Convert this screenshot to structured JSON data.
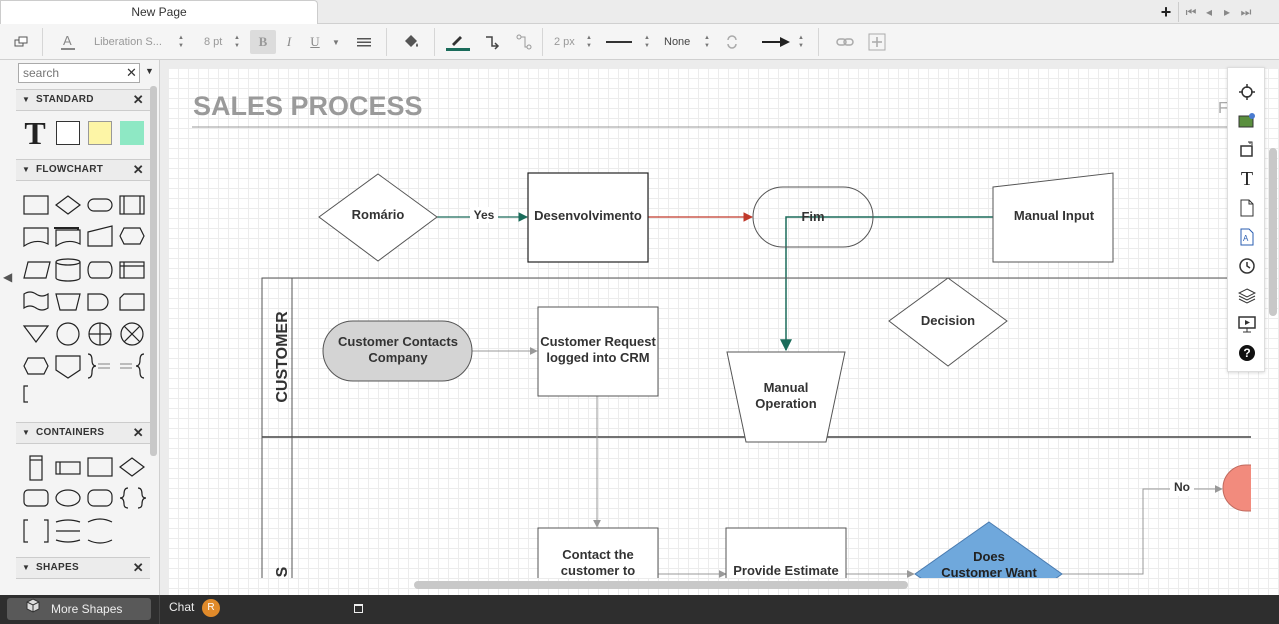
{
  "tabs": {
    "active": "New Page"
  },
  "toolbar": {
    "font_family": "Liberation S...",
    "font_size": "8 pt",
    "line_width": "2 px",
    "line_end": "None"
  },
  "sidebar": {
    "search_placeholder": "search",
    "sections": {
      "standard": "STANDARD",
      "flowchart": "FLOWCHART",
      "containers": "CONTAINERS",
      "shapes": "SHAPES"
    },
    "text_tool_glyph": "T"
  },
  "diagram": {
    "title": "SALES PROCESS",
    "title_right": "F",
    "nodes": {
      "romario": "Romário",
      "desenvolvimento": "Desenvolvimento",
      "fim": "Fim",
      "manual_input": "Manual Input",
      "customer_contacts_1": "Customer Contacts",
      "customer_contacts_2": "Company",
      "customer_request_1": "Customer Request",
      "customer_request_2": "logged into CRM",
      "manual_operation_1": "Manual",
      "manual_operation_2": "Operation",
      "decision": "Decision",
      "contact_customer_1": "Contact the",
      "contact_customer_2": "customer to",
      "provide_estimate": "Provide Estimate",
      "does_customer_want_1": "Does",
      "does_customer_want_2": "Customer Want"
    },
    "edges": {
      "yes": "Yes",
      "no": "No"
    },
    "lanes": {
      "customer": "CUSTOMER",
      "sales": "S"
    },
    "colors": {
      "green_edge": "#1a6b5a",
      "red_edge": "#c0392b",
      "gray_fill": "#d4d4d4",
      "blue_fill": "#6fa8dc",
      "salmon_fill": "#f28b7d"
    }
  },
  "bottom": {
    "more_shapes": "More Shapes",
    "chat": "Chat",
    "chat_badge": "R"
  }
}
